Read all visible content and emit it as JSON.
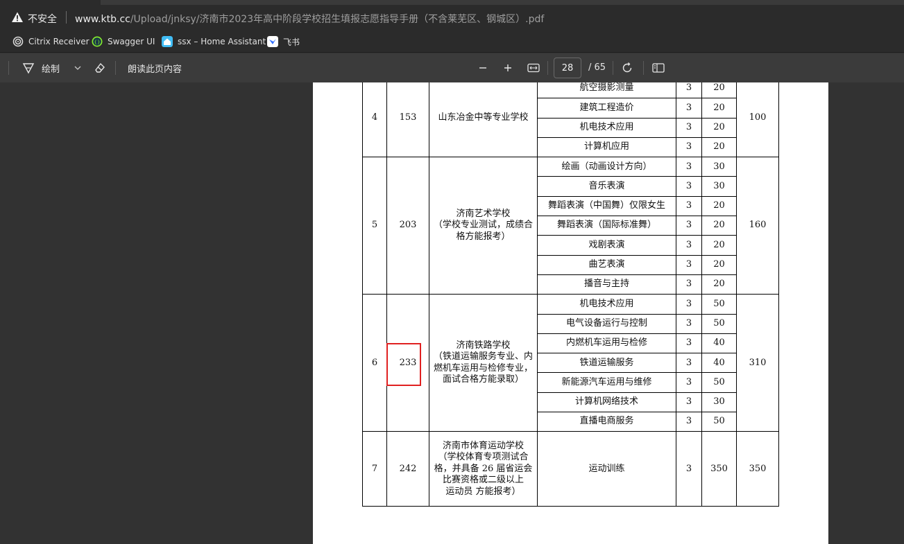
{
  "address_bar": {
    "security_label": "不安全",
    "url_host": "www.ktb.cc",
    "url_path": "/Upload/jnksy/济南市2023年高中阶段学校招生填报志愿指导手册（不含莱芜区、钢城区）.pdf"
  },
  "bookmarks": [
    {
      "label": "Citrix Receiver",
      "icon": "citrix-icon"
    },
    {
      "label": "Swagger UI",
      "icon": "swagger-icon"
    },
    {
      "label": "ssx – Home Assistant",
      "icon": "home-assistant-icon"
    },
    {
      "label": "飞书",
      "icon": "feishu-icon"
    }
  ],
  "toolbar": {
    "draw_label": "绘制",
    "read_aloud_label": "朗读此页内容",
    "current_page": "28",
    "total_pages": "/ 65"
  },
  "table": {
    "groups": [
      {
        "index": "4",
        "code": "153",
        "school": [
          "山东冶金中等专业学校"
        ],
        "total": "100",
        "majors": [
          {
            "name": "航空摄影测量",
            "years": "3",
            "plan": "20"
          },
          {
            "name": "建筑工程造价",
            "years": "3",
            "plan": "20"
          },
          {
            "name": "机电技术应用",
            "years": "3",
            "plan": "20"
          },
          {
            "name": "计算机应用",
            "years": "3",
            "plan": "20"
          }
        ]
      },
      {
        "index": "5",
        "code": "203",
        "school": [
          "济南艺术学校",
          "（学校专业测试，成绩合",
          "格方能报考）"
        ],
        "total": "160",
        "majors": [
          {
            "name": "绘画（动画设计方向）",
            "years": "3",
            "plan": "30"
          },
          {
            "name": "音乐表演",
            "years": "3",
            "plan": "30"
          },
          {
            "name": "舞蹈表演（中国舞）仅限女生",
            "years": "3",
            "plan": "20"
          },
          {
            "name": "舞蹈表演（国际标准舞）",
            "years": "3",
            "plan": "20"
          },
          {
            "name": "戏剧表演",
            "years": "3",
            "plan": "20"
          },
          {
            "name": "曲艺表演",
            "years": "3",
            "plan": "20"
          },
          {
            "name": "播音与主持",
            "years": "3",
            "plan": "20"
          }
        ]
      },
      {
        "index": "6",
        "code": "233",
        "school": [
          "济南铁路学校",
          "（铁道运输服务专业、内",
          "燃机车运用与检修专业，",
          "面试合格方能录取）"
        ],
        "total": "310",
        "majors": [
          {
            "name": "机电技术应用",
            "years": "3",
            "plan": "50"
          },
          {
            "name": "电气设备运行与控制",
            "years": "3",
            "plan": "50"
          },
          {
            "name": "内燃机车运用与检修",
            "years": "3",
            "plan": "40"
          },
          {
            "name": "铁道运输服务",
            "years": "3",
            "plan": "40"
          },
          {
            "name": "新能源汽车运用与维修",
            "years": "3",
            "plan": "50"
          },
          {
            "name": "计算机网络技术",
            "years": "3",
            "plan": "30"
          },
          {
            "name": "直播电商服务",
            "years": "3",
            "plan": "50"
          }
        ]
      },
      {
        "index": "7",
        "code": "242",
        "school": [
          "济南市体育运动学校",
          "（学校体育专项测试合",
          "格，并具备 26 届省运会",
          "比赛资格或二级以上",
          "运动员 方能报考）"
        ],
        "total": "350",
        "majors": [
          {
            "name": "运动训练",
            "years": "3",
            "plan": "350"
          }
        ]
      }
    ]
  },
  "colors": {
    "highlight_box": "#e02020",
    "viewer_bg": "#323232",
    "toolbar_bg": "#3b3b3b"
  }
}
